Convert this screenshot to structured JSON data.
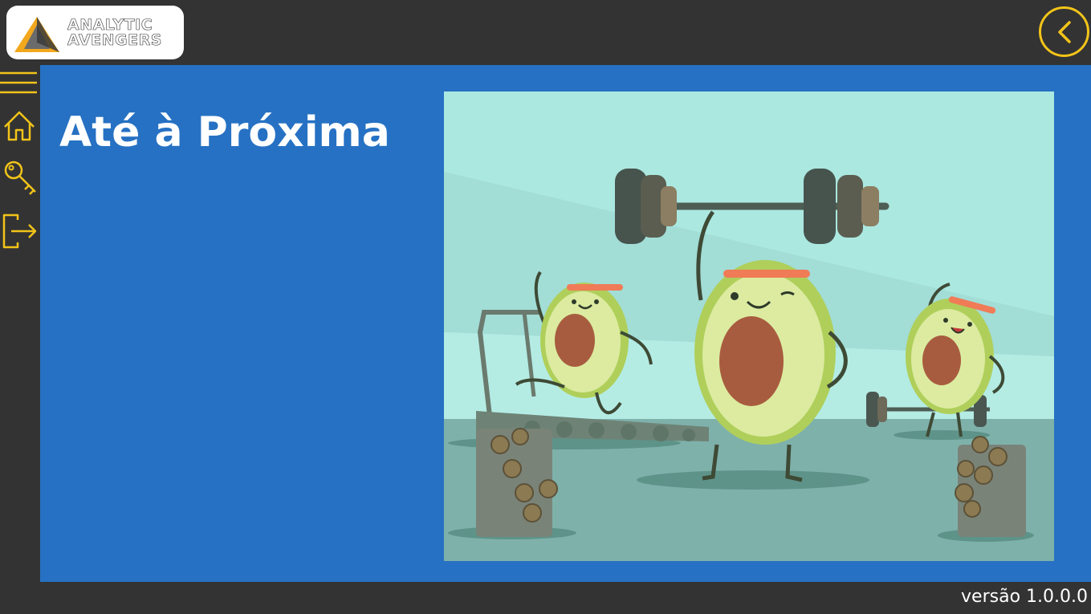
{
  "header": {
    "logo": {
      "line1": "ANALYTIC",
      "line2": "AVENGERS",
      "icon": "triangle-logo-icon"
    },
    "back_icon": "chevron-left-icon"
  },
  "sidebar": {
    "items": [
      {
        "icon": "menu-icon"
      },
      {
        "icon": "home-icon"
      },
      {
        "icon": "key-icon"
      },
      {
        "icon": "logout-icon"
      }
    ]
  },
  "main": {
    "title": "Até à Próxima",
    "image": "avocado-gym-illustration"
  },
  "footer": {
    "version": "versão 1.0.0.0"
  },
  "colors": {
    "background": "#333333",
    "panel": "#2671C3",
    "accent": "#F2C419",
    "text": "#FFFFFF"
  }
}
